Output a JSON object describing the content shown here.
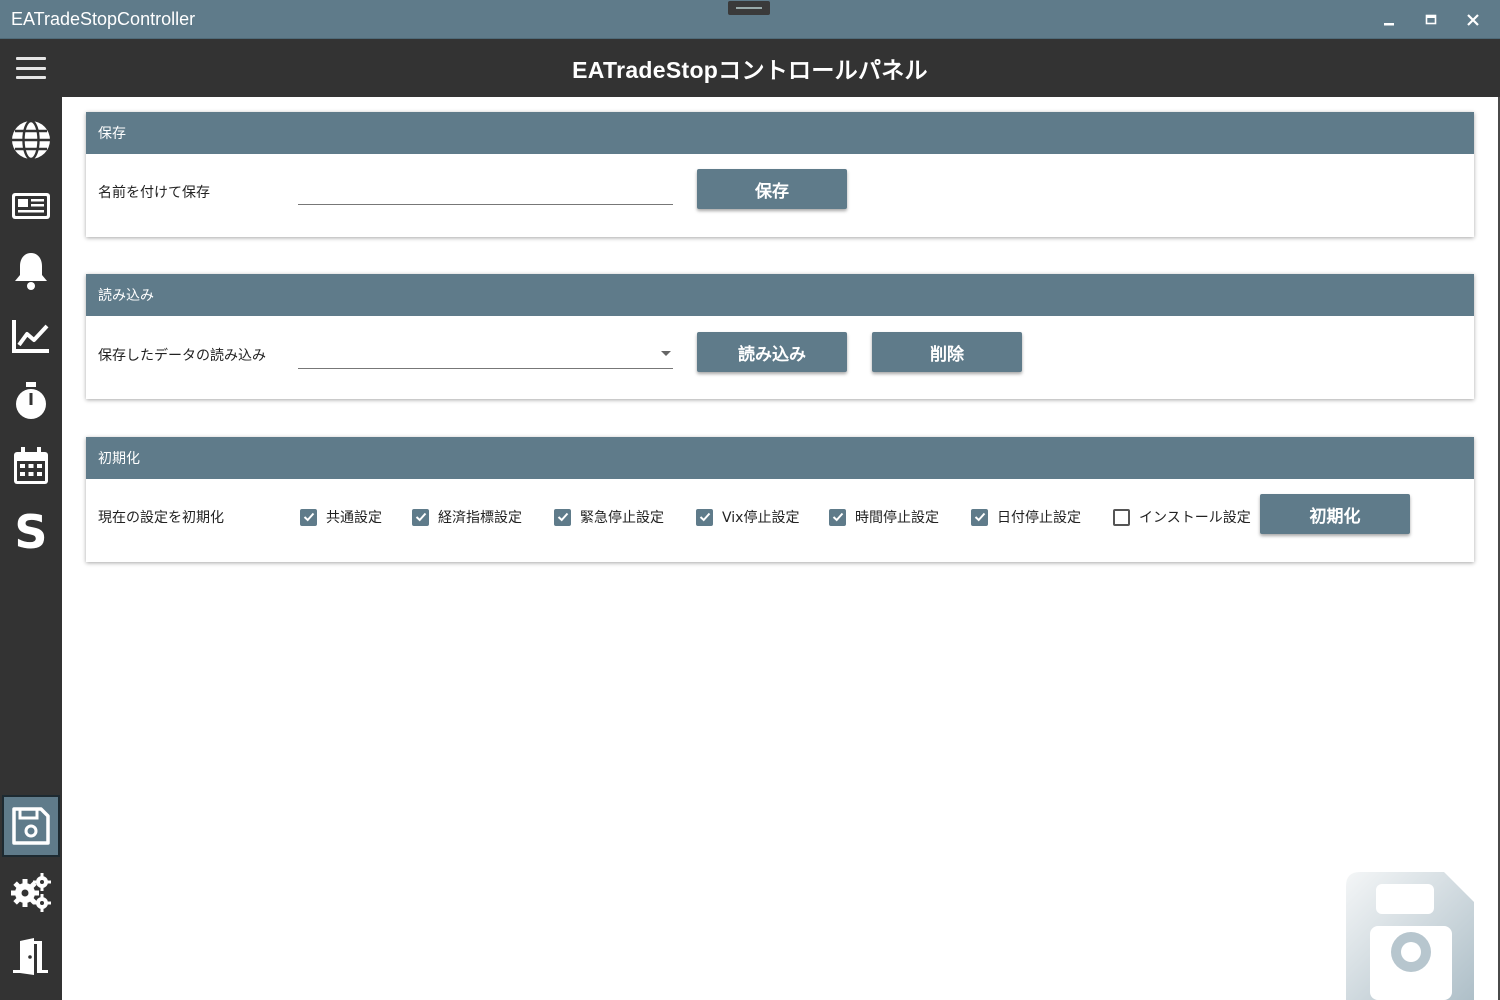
{
  "window": {
    "title": "EATradeStopController"
  },
  "header": {
    "title": "EATradeStopコントロールパネル"
  },
  "sidebar": {
    "items": [
      {
        "icon": "globe-icon"
      },
      {
        "icon": "newspaper-icon"
      },
      {
        "icon": "bell-icon"
      },
      {
        "icon": "chart-line-icon"
      },
      {
        "icon": "stopwatch-icon"
      },
      {
        "icon": "calendar-icon"
      },
      {
        "icon": "s-letter-icon"
      },
      {
        "icon": "floppy-disk-icon",
        "active": true
      },
      {
        "icon": "gears-icon"
      },
      {
        "icon": "exit-door-icon"
      }
    ]
  },
  "save_section": {
    "title": "保存",
    "label": "名前を付けて保存",
    "input_value": "",
    "button": "保存"
  },
  "load_section": {
    "title": "読み込み",
    "label": "保存したデータの読み込み",
    "selected": "",
    "load_button": "読み込み",
    "delete_button": "削除"
  },
  "reset_section": {
    "title": "初期化",
    "label": "現在の設定を初期化",
    "options": [
      {
        "label": "共通設定",
        "checked": true
      },
      {
        "label": "経済指標設定",
        "checked": true
      },
      {
        "label": "緊急停止設定",
        "checked": true
      },
      {
        "label": "Vix停止設定",
        "checked": true
      },
      {
        "label": "時間停止設定",
        "checked": true
      },
      {
        "label": "日付停止設定",
        "checked": true
      },
      {
        "label": "インストール設定",
        "checked": false
      }
    ],
    "button": "初期化"
  },
  "colors": {
    "accent": "#5f7b8a",
    "dark": "#333333"
  }
}
